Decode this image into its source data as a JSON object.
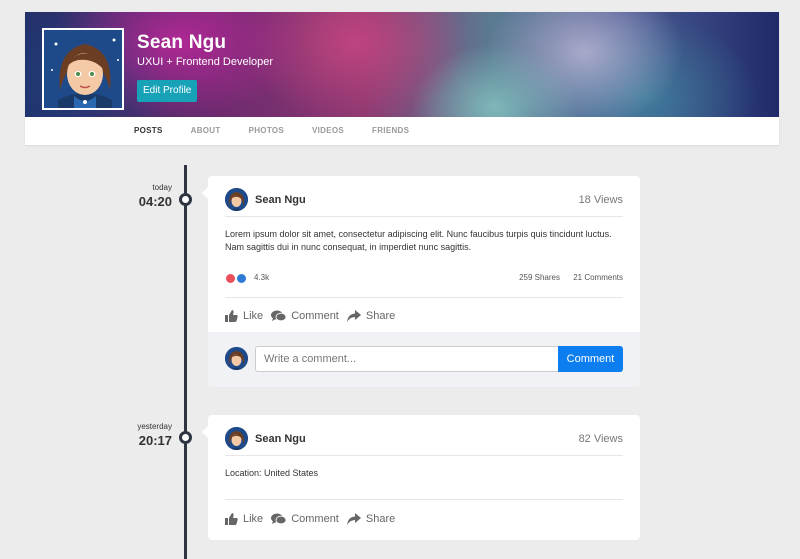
{
  "profile": {
    "name": "Sean Ngu",
    "role": "UXUI + Frontend Developer",
    "edit_label": "Edit Profile"
  },
  "tabs": [
    {
      "label": "POSTS",
      "active": true
    },
    {
      "label": "ABOUT",
      "active": false
    },
    {
      "label": "PHOTOS",
      "active": false
    },
    {
      "label": "VIDEOS",
      "active": false
    },
    {
      "label": "FRIENDS",
      "active": false
    }
  ],
  "posts": [
    {
      "day": "today",
      "time": "04:20",
      "author": "Sean Ngu",
      "views": "18 Views",
      "text": "Lorem ipsum dolor sit amet, consectetur adipiscing elit. Nunc faucibus turpis quis tincidunt luctus. Nam sagittis dui in nunc consequat, in imperdiet nunc sagittis.",
      "reactions": "4.3k",
      "shares": "259 Shares",
      "comments": "21 Comments",
      "actions": {
        "like": "Like",
        "comment": "Comment",
        "share": "Share"
      },
      "comment_placeholder": "Write a comment...",
      "comment_button": "Comment"
    },
    {
      "day": "yesterday",
      "time": "20:17",
      "author": "Sean Ngu",
      "views": "82 Views",
      "text": "Location: United States",
      "actions": {
        "like": "Like",
        "comment": "Comment",
        "share": "Share"
      }
    }
  ],
  "colors": {
    "accent": "#17a2b8",
    "primary": "#0d7ef0",
    "timeline": "#2e3440"
  }
}
